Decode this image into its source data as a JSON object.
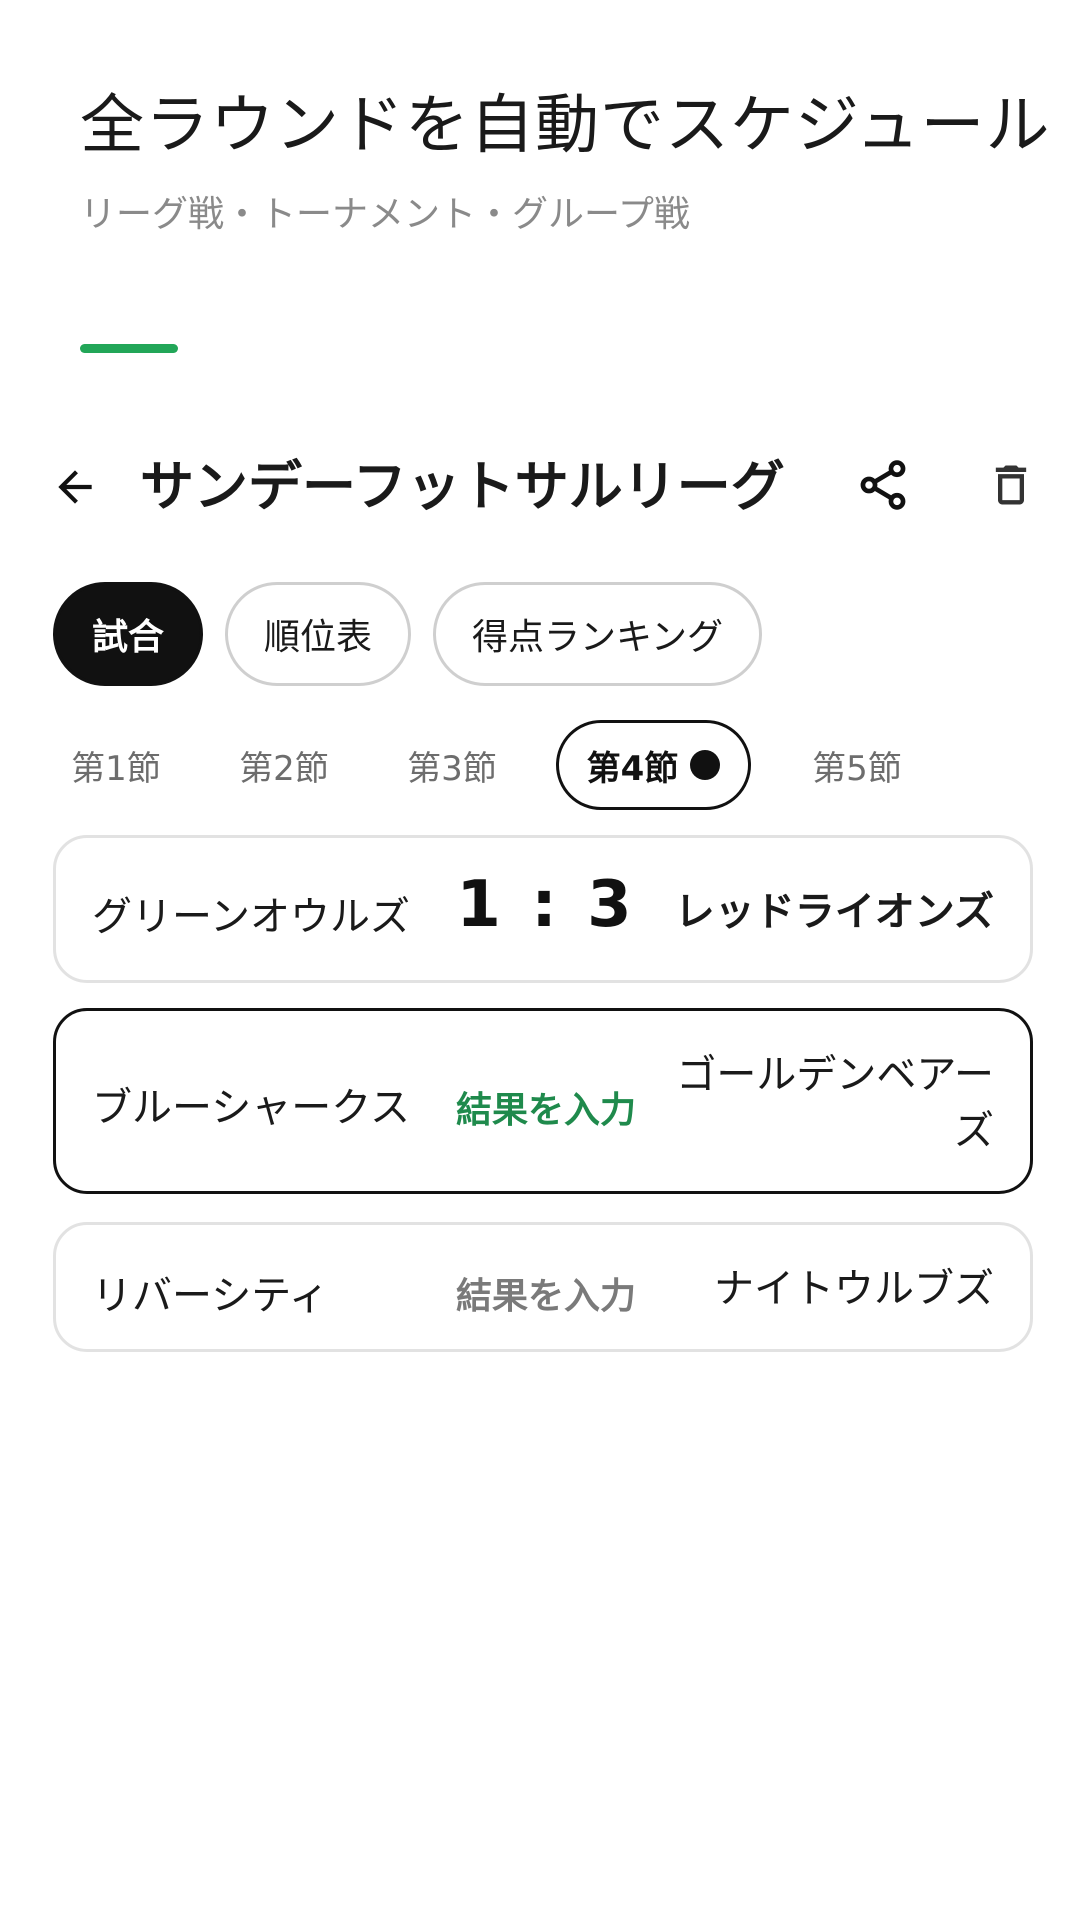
{
  "hero": {
    "title": "全ラウンドを自動でスケジュール",
    "subtitle": "リーグ戦・トーナメント・グループ戦"
  },
  "accent_color": "#22a658",
  "app_bar": {
    "back_icon": "arrow-left-icon",
    "title": "サンデーフットサルリーグ",
    "share_icon": "share-icon",
    "delete_icon": "trash-icon"
  },
  "tabs": [
    {
      "label": "試合",
      "active": true
    },
    {
      "label": "順位表",
      "active": false
    },
    {
      "label": "得点ランキング",
      "active": false
    }
  ],
  "rounds": [
    {
      "label": "第1節"
    },
    {
      "label": "第2節"
    },
    {
      "label": "第3節"
    },
    {
      "label": "第4節",
      "active": true
    },
    {
      "label": "第5節"
    }
  ],
  "matches": [
    {
      "home": "グリーンオウルズ",
      "away": "レッドライオンズ",
      "score_home": "1",
      "score_sep": ":",
      "score_away": "3",
      "score": "1 : 3"
    },
    {
      "home": "ブルーシャークス",
      "away": "ゴールデンベアーズ",
      "action": "結果を入力",
      "action_color": "#1f8a4c"
    },
    {
      "home": "リバーシティ",
      "away": "ナイトウルブズ",
      "action": "結果を入力",
      "action_color": "#7a7a7a"
    }
  ]
}
